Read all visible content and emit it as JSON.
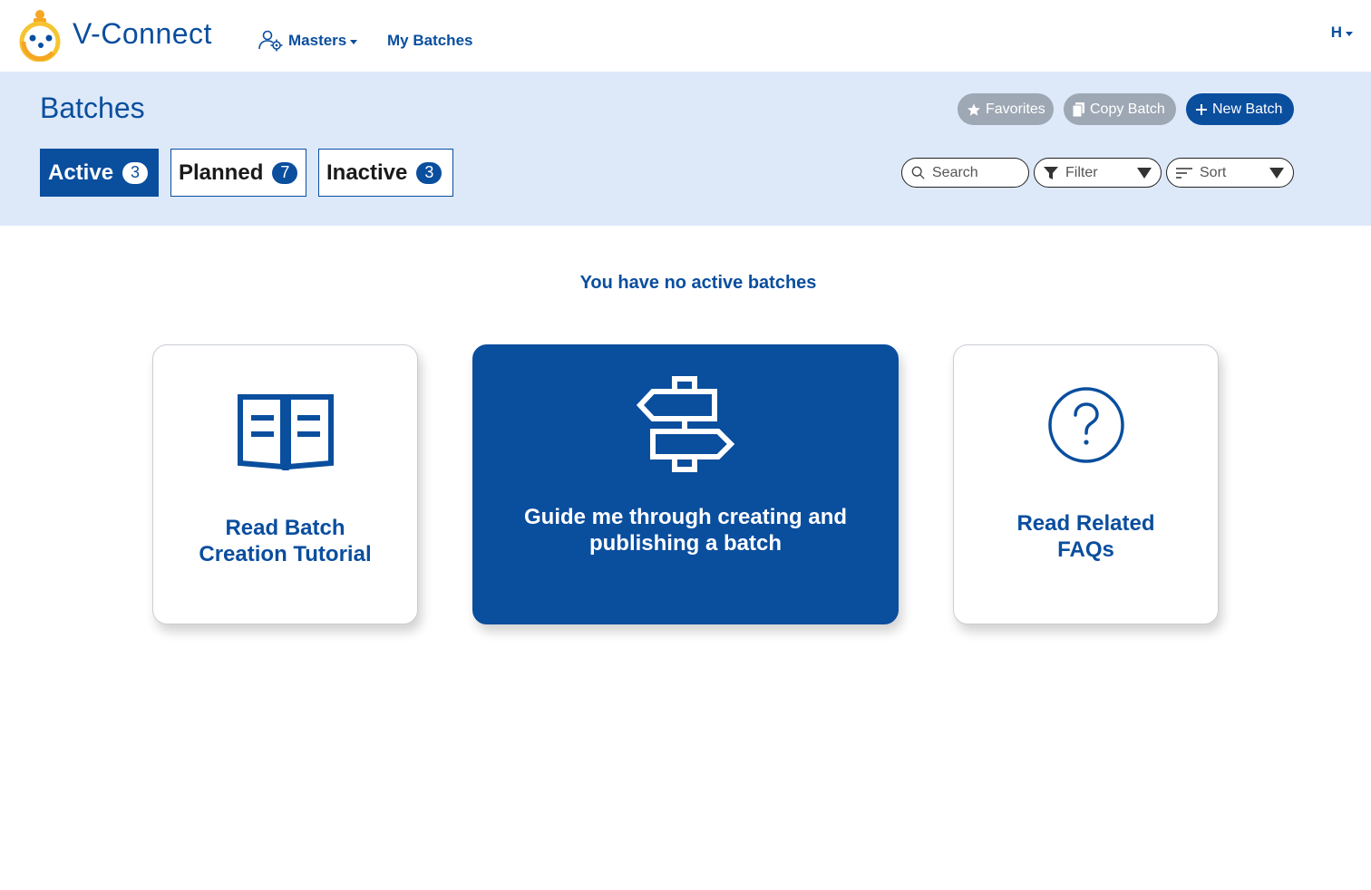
{
  "brand": {
    "name": "V-Connect"
  },
  "nav": {
    "masters_label": "Masters",
    "my_batches_label": "My Batches",
    "user_initial": "H"
  },
  "header": {
    "title": "Batches",
    "favorites_label": "Favorites",
    "copy_batch_label": "Copy Batch",
    "new_batch_label": "New Batch"
  },
  "tabs": [
    {
      "label": "Active",
      "count": "3"
    },
    {
      "label": "Planned",
      "count": "7"
    },
    {
      "label": "Inactive",
      "count": "3"
    }
  ],
  "controls": {
    "search_placeholder": "Search",
    "filter_label": "Filter",
    "sort_label": "Sort"
  },
  "empty_state": {
    "message": "You have no active batches",
    "cards": [
      {
        "line1": "Read Batch",
        "line2": "Creation Tutorial",
        "icon": "open-book-icon"
      },
      {
        "line1": "Guide me through creating and",
        "line2": "publishing a batch",
        "icon": "signpost-icon"
      },
      {
        "line1": "Read Related",
        "line2": "FAQs",
        "icon": "question-circle-icon"
      }
    ]
  },
  "colors": {
    "primary": "#0a4e9e",
    "band": "#dde9f9",
    "disabled": "#9ea8b4"
  }
}
